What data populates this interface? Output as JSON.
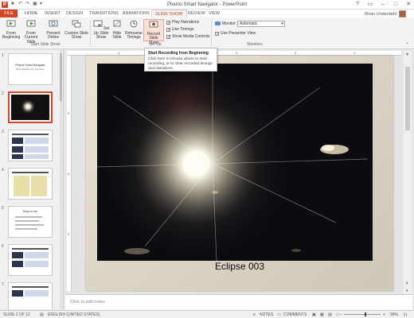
{
  "window": {
    "title": "Pharos Smart Navigator - PowerPoint",
    "user_name": "Brian Underdahl"
  },
  "tabs": [
    "FILE",
    "HOME",
    "INSERT",
    "DESIGN",
    "TRANSITIONS",
    "ANIMATIONS",
    "SLIDE SHOW",
    "REVIEW",
    "VIEW"
  ],
  "active_tab": "SLIDE SHOW",
  "ribbon": {
    "start": {
      "from_beginning": "From Beginning",
      "from_current": "From Current Slide",
      "present_online": "Present Online",
      "custom_show": "Custom Slide Show",
      "group_label": "Start Slide Show"
    },
    "setup": {
      "set_up_show": "Set Up Slide Show",
      "hide_slide": "Hide Slide",
      "rehearse": "Rehearse Timings",
      "record": "Record Slide Show",
      "play_narrations": "Play Narrations",
      "use_timings": "Use Timings",
      "show_media_controls": "Show Media Controls",
      "group_label": "Set Up"
    },
    "monitors": {
      "monitor_label": "Monitor:",
      "monitor_value": "Automatic",
      "use_presenter_view": "Use Presenter View",
      "group_label": "Monitors"
    }
  },
  "tooltip": {
    "title": "Start Recording from Beginning",
    "body": "Click here to choose where to start recording, or to clear recorded timings and narrations."
  },
  "thumbnails": [
    {
      "num": "1",
      "title": "Pharos Smart Navigator",
      "subtitle": "GPS navigation for your phone"
    },
    {
      "num": "2"
    },
    {
      "num": "3"
    },
    {
      "num": "4"
    },
    {
      "num": "5",
      "title": "Easy to use"
    },
    {
      "num": "6"
    },
    {
      "num": "7"
    }
  ],
  "ruler": {
    "h_labels": [
      "4",
      "2",
      "0",
      "2",
      "4"
    ],
    "v_labels": [
      "2",
      "0",
      "2"
    ]
  },
  "slide": {
    "caption": "Eclipse 003"
  },
  "notes": {
    "placeholder": "Click to add notes"
  },
  "status": {
    "slide_info": "SLIDE 2 OF 12",
    "language": "ENGLISH (UNITED STATES)",
    "notes_btn": "NOTES",
    "comments_btn": "COMMENTS",
    "zoom": "99%"
  },
  "colors": {
    "accent": "#d24726",
    "selected_thumb_border": "#d24726"
  }
}
